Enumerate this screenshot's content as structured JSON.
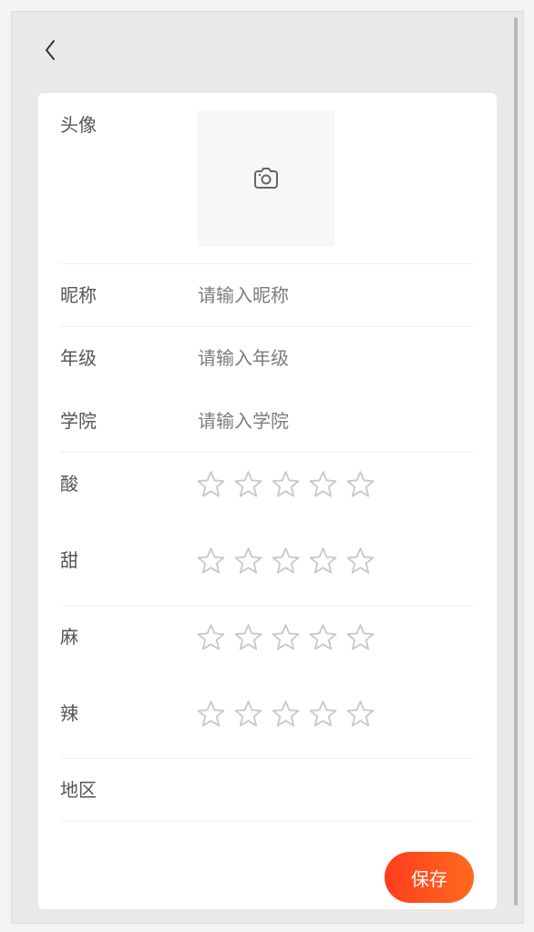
{
  "header": {
    "back_icon": "chevron-left-icon"
  },
  "form": {
    "avatar": {
      "label": "头像",
      "upload_icon": "camera-icon"
    },
    "nickname": {
      "label": "昵称",
      "placeholder": "请输入昵称",
      "value": ""
    },
    "grade": {
      "label": "年级",
      "placeholder": "请输入年级",
      "value": ""
    },
    "college": {
      "label": "学院",
      "placeholder": "请输入学院",
      "value": ""
    },
    "ratings": [
      {
        "label": "酸",
        "rating": 0,
        "max": 5
      },
      {
        "label": "甜",
        "rating": 0,
        "max": 5
      },
      {
        "label": "麻",
        "rating": 0,
        "max": 5
      },
      {
        "label": "辣",
        "rating": 0,
        "max": 5
      }
    ],
    "region": {
      "label": "地区",
      "value": ""
    }
  },
  "actions": {
    "save_label": "保存"
  },
  "colors": {
    "background": "#ebe9e7",
    "card": "#ffffff",
    "star_outline": "#c8c8c8",
    "save_gradient_start": "#ff3d1f",
    "save_gradient_end": "#ff6a1e"
  }
}
